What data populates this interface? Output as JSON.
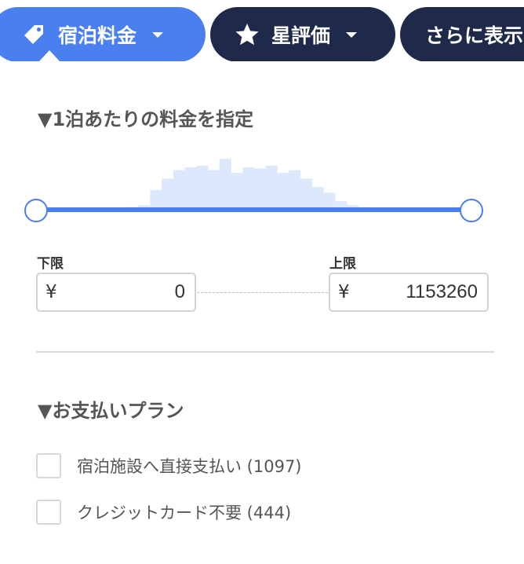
{
  "filter_tabs": {
    "price": {
      "label": "宿泊料金",
      "icon": "price-tag-icon"
    },
    "stars": {
      "label": "星評価",
      "icon": "star-icon"
    },
    "more": {
      "label": "さらに表示"
    }
  },
  "price_section": {
    "title": "▼1泊あたりの料金を指定",
    "min_label": "下限",
    "max_label": "上限",
    "currency_symbol": "¥",
    "min_value": "0",
    "max_value": "1153260",
    "histogram_heights": [
      0.02,
      0.02,
      0.02,
      0.02,
      0.02,
      0.03,
      0.03,
      0.04,
      0.05,
      0.08,
      0.35,
      0.55,
      0.7,
      0.75,
      0.78,
      0.7,
      0.9,
      0.65,
      0.75,
      0.73,
      0.78,
      0.65,
      0.7,
      0.55,
      0.4,
      0.3,
      0.15,
      0.08,
      0.05,
      0.04,
      0.03,
      0.02,
      0.02,
      0.02,
      0.02,
      0.02,
      0.02,
      0.02
    ],
    "slider_range": [
      0,
      1
    ]
  },
  "payment_section": {
    "title": "▼お支払いプラン",
    "options": [
      {
        "label": "宿泊施設へ直接支払い (1097)",
        "checked": false
      },
      {
        "label": "クレジットカード不要 (444)",
        "checked": false
      }
    ]
  },
  "colors": {
    "accent": "#4a7ff0",
    "navy": "#1f2a4a",
    "histogram": "#dce8fb"
  }
}
